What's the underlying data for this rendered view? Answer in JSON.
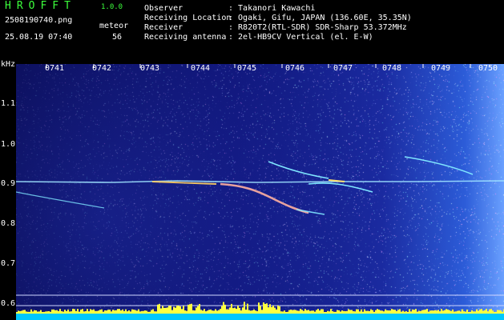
{
  "header": {
    "app_title": "HROFFT",
    "app_version": "1.0.0",
    "file_name": "2508190740.png",
    "date_time": "25.08.19 07:40",
    "meteor_label": "meteor",
    "meteor_count": "56",
    "info": [
      {
        "key": "Observer",
        "value": ": Takanori Kawachi"
      },
      {
        "key": "Receiving Location",
        "value": ": Ogaki, Gifu, JAPAN (136.60E, 35.35N)"
      },
      {
        "key": "Receiver",
        "value": ": R820T2(RTL-SDR) SDR-Sharp 53.372MHz"
      },
      {
        "key": "Receiving antenna",
        "value": ": 2el-HB9CV Vertical (el. E-W)"
      }
    ]
  },
  "axis": {
    "unit": "kHz",
    "time_labels": [
      "0741",
      "0742",
      "0743",
      "0744",
      "0745",
      "0746",
      "0747",
      "0748",
      "0749",
      "0750"
    ],
    "freq_labels": [
      "1.1",
      "1.0",
      "0.9",
      "0.8",
      "0.7",
      "0.6"
    ]
  },
  "colors": {
    "title_green": "#3cff3c",
    "carrier": "#9fe3ff",
    "echo": "#7fe6ff",
    "baseline": "#ffff40",
    "baseline_base": "#00c8ff"
  }
}
